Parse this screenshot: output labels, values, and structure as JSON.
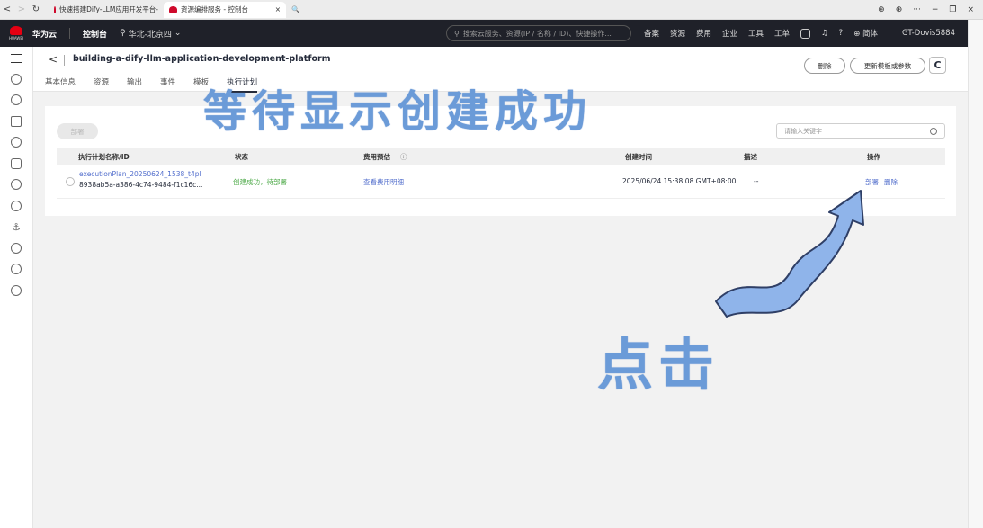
{
  "browser": {
    "nav": [
      "<",
      ">",
      "↻"
    ],
    "tabs": [
      {
        "label": "快速搭建Dify-LLM应用开发平台-"
      },
      {
        "label": "资源编排服务 - 控制台",
        "close": "×"
      },
      {
        "label": "🔍"
      }
    ],
    "controls": [
      "⊕",
      "⊕",
      "···",
      "−",
      "❐",
      "×"
    ]
  },
  "topnav": {
    "logo_text": "HUAWEI",
    "brand": "华为云",
    "console": "控制台",
    "region": "华北-北京四",
    "search_placeholder": "搜索云服务、资源(IP / 名称 / ID)、快捷操作...",
    "links": [
      "备案",
      "资源",
      "费用",
      "企业",
      "工具",
      "工单"
    ],
    "lang": "简体",
    "user": "GT-Dovis5884"
  },
  "header": {
    "back": "<",
    "title": "building-a-dify-llm-application-development-platform",
    "tabs": [
      "基本信息",
      "资源",
      "输出",
      "事件",
      "模板",
      "执行计划"
    ],
    "delete_btn": "删除",
    "update_btn": "更新模板或参数",
    "refresh": "C"
  },
  "card": {
    "deploy_btn": "部署",
    "search_placeholder": "请输入关键字",
    "columns": [
      "执行计划名称/ID",
      "状态",
      "费用预估",
      "创建时间",
      "描述",
      "操作"
    ],
    "rows": [
      {
        "name": "executionPlan_20250624_1538_t4pl",
        "id": "8938ab5a-a386-4c74-9484-f1c16c...",
        "status": "创建成功，待部署",
        "cost": "查看费用明细",
        "created": "2025/06/24 15:38:08 GMT+08:00",
        "desc": "--",
        "op_deploy": "部署",
        "op_delete": "删除"
      }
    ]
  },
  "annotations": {
    "top": "等待显示创建成功",
    "bottom": "点击"
  },
  "colors": {
    "accent": "#526ecc",
    "success": "#50ab4b",
    "annotation": "#6b9bd8"
  }
}
